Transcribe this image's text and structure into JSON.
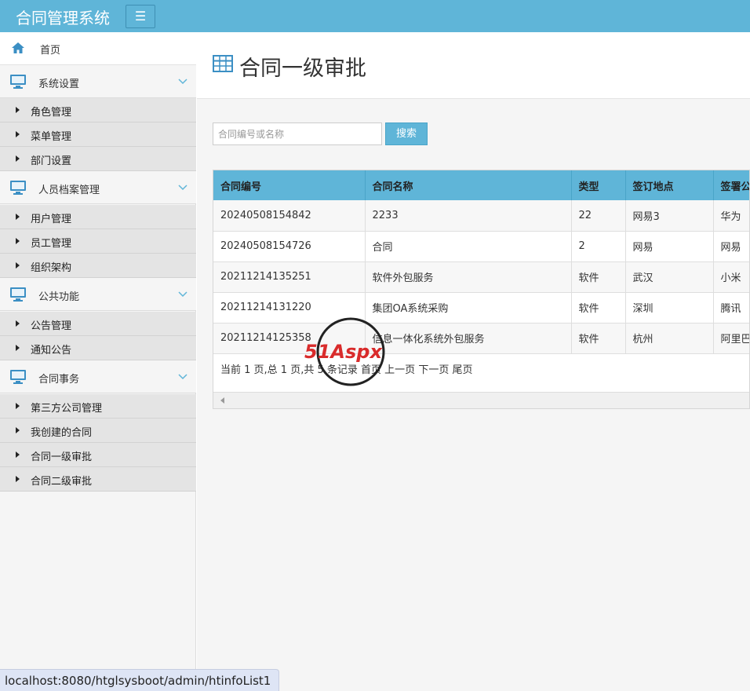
{
  "header": {
    "brand": "合同管理系统",
    "toggle_icon": "menu-icon"
  },
  "sidebar": {
    "home": "首页",
    "groups": [
      {
        "label": "系统设置",
        "items": [
          "角色管理",
          "菜单管理",
          "部门设置"
        ]
      },
      {
        "label": "人员档案管理",
        "items": [
          "用户管理",
          "员工管理",
          "组织架构"
        ]
      },
      {
        "label": "公共功能",
        "items": [
          "公告管理",
          "通知公告"
        ]
      },
      {
        "label": "合同事务",
        "items": [
          "第三方公司管理",
          "我创建的合同",
          "合同一级审批",
          "合同二级审批"
        ]
      }
    ]
  },
  "main": {
    "title": "合同一级审批",
    "search": {
      "placeholder": "合同编号或名称",
      "value": "",
      "button": "搜索"
    },
    "table": {
      "headers": [
        "合同编号",
        "合同名称",
        "类型",
        "签订地点",
        "签署公"
      ],
      "rows": [
        [
          "20240508154842",
          "2233",
          "22",
          "网易3",
          "华为"
        ],
        [
          "20240508154726",
          "合同",
          "2",
          "网易",
          "网易"
        ],
        [
          "20211214135251",
          "软件外包服务",
          "软件",
          "武汉",
          "小米"
        ],
        [
          "20211214131220",
          "集团OA系统采购",
          "软件",
          "深圳",
          "腾讯"
        ],
        [
          "20211214125358",
          "信息一体化系统外包服务",
          "软件",
          "杭州",
          "阿里巴"
        ]
      ]
    },
    "pager": {
      "summary": "当前 1 页,总 1 页,共 5 条记录",
      "first": "首页",
      "prev": "上一页",
      "next": "下一页",
      "last": "尾页"
    }
  },
  "watermark": {
    "text": "51Aspx"
  },
  "status_url": "localhost:8080/htglsysboot/admin/htinfoList1",
  "colors": {
    "accent": "#5fb5d8",
    "icon_blue": "#3b8fc4"
  }
}
